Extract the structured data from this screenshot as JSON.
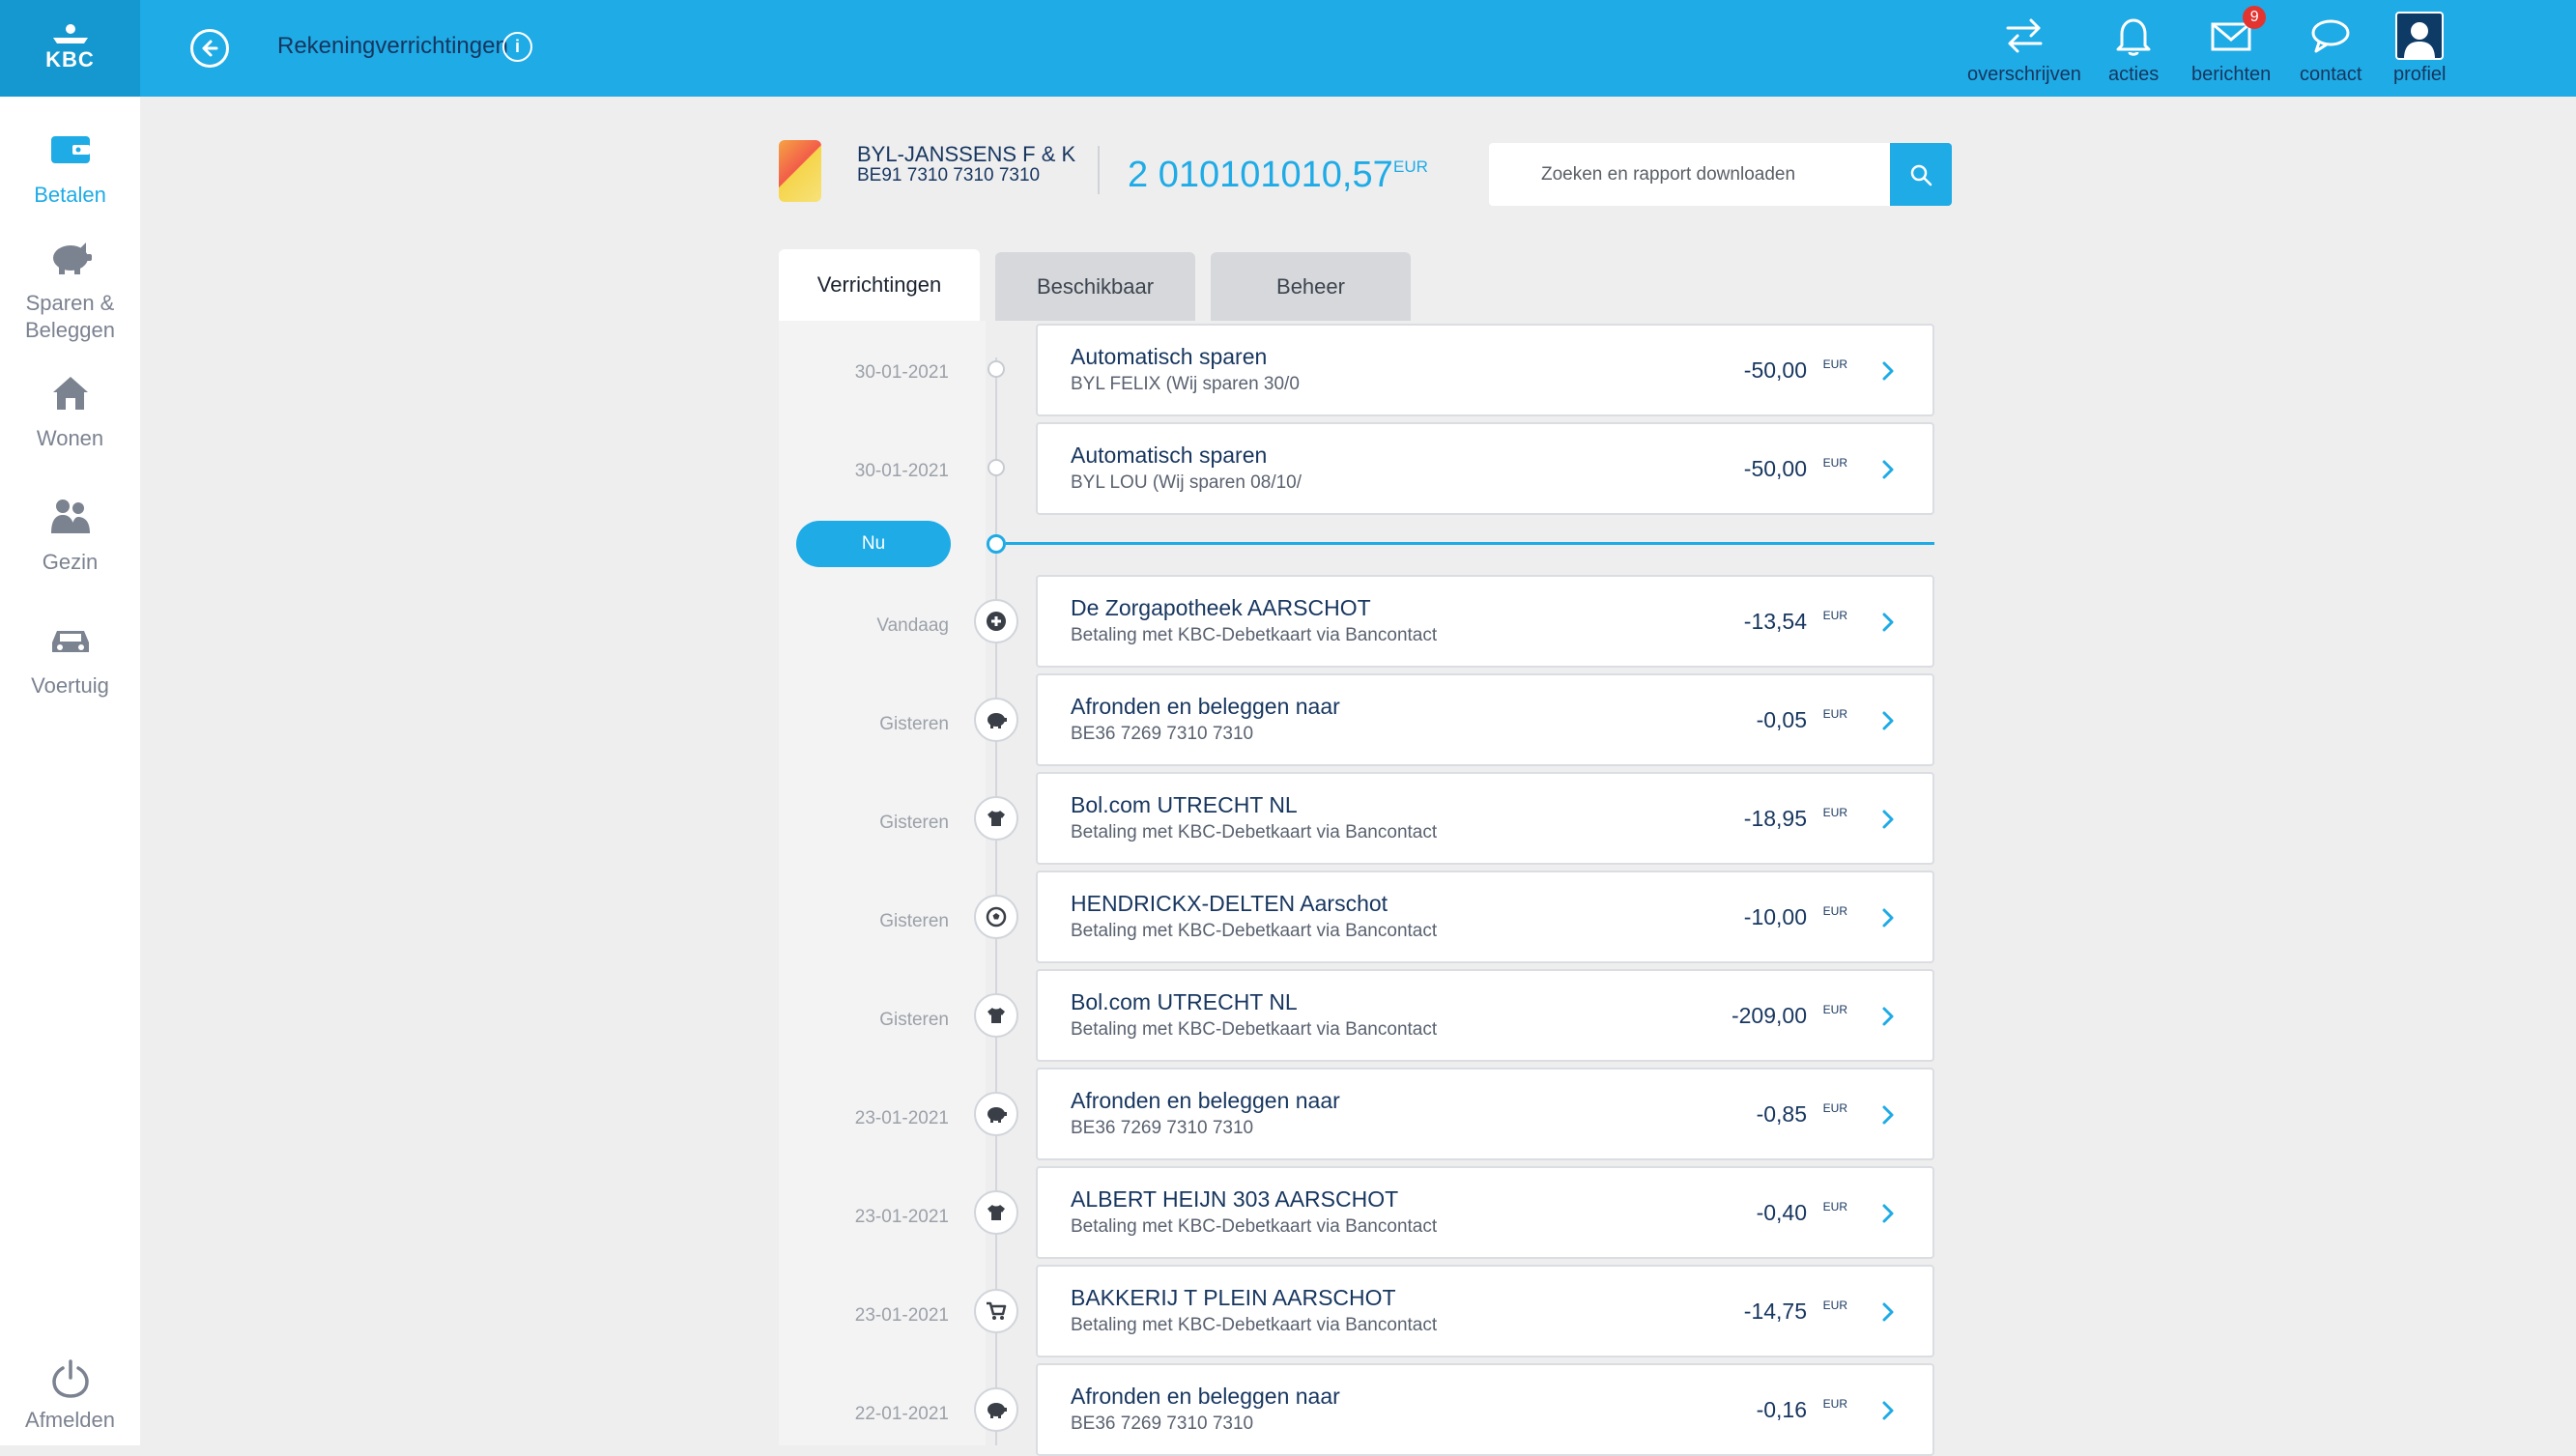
{
  "header": {
    "logo_text": "KBC",
    "title": "Rekeningverrichtingen",
    "actions": [
      {
        "label": "overschrijven",
        "icon": "transfer-icon"
      },
      {
        "label": "acties",
        "icon": "bell-icon"
      },
      {
        "label": "berichten",
        "icon": "mail-icon",
        "badge": "9"
      },
      {
        "label": "contact",
        "icon": "chat-icon"
      },
      {
        "label": "profiel",
        "icon": "profile-icon"
      }
    ]
  },
  "sidebar": {
    "items": [
      {
        "label": "Betalen",
        "icon": "wallet-icon"
      },
      {
        "label": "Sparen & Beleggen",
        "icon": "piggybank-icon"
      },
      {
        "label": "Wonen",
        "icon": "house-icon"
      },
      {
        "label": "Gezin",
        "icon": "family-icon"
      },
      {
        "label": "Voertuig",
        "icon": "car-icon"
      }
    ],
    "logout_label": "Afmelden"
  },
  "account": {
    "name": "BYL-JANSSENS F & K",
    "iban": "BE91 7310 7310 7310",
    "balance": "2 010101010,57",
    "currency": "EUR"
  },
  "search": {
    "placeholder": "Zoeken en rapport downloaden"
  },
  "tabs": [
    {
      "label": "Verrichtingen",
      "active": true
    },
    {
      "label": "Beschikbaar",
      "active": false
    },
    {
      "label": "Beheer",
      "active": false
    }
  ],
  "now_label": "Nu",
  "future_transactions": [
    {
      "date": "30-01-2021",
      "title": "Automatisch sparen",
      "subtitle": "BYL FELIX (Wij sparen 30/0",
      "amount": "-50,00",
      "currency": "EUR"
    },
    {
      "date": "30-01-2021",
      "title": "Automatisch sparen",
      "subtitle": "BYL LOU (Wij sparen 08/10/",
      "amount": "-50,00",
      "currency": "EUR"
    }
  ],
  "transactions": [
    {
      "date": "Vandaag",
      "icon": "medical-icon",
      "title": "De Zorgapotheek AARSCHOT",
      "subtitle": "Betaling met KBC-Debetkaart via Bancontact",
      "amount": "-13,54",
      "currency": "EUR"
    },
    {
      "date": "Gisteren",
      "icon": "piggybank-icon",
      "title": "Afronden en beleggen naar",
      "subtitle": "BE36 7269 7310 7310",
      "amount": "-0,05",
      "currency": "EUR"
    },
    {
      "date": "Gisteren",
      "icon": "shirt-icon",
      "title": "Bol.com UTRECHT NL",
      "subtitle": "Betaling met KBC-Debetkaart via Bancontact",
      "amount": "-18,95",
      "currency": "EUR"
    },
    {
      "date": "Gisteren",
      "icon": "football-icon",
      "title": "HENDRICKX-DELTEN Aarschot",
      "subtitle": "Betaling met KBC-Debetkaart via Bancontact",
      "amount": "-10,00",
      "currency": "EUR"
    },
    {
      "date": "Gisteren",
      "icon": "shirt-icon",
      "title": "Bol.com UTRECHT NL",
      "subtitle": "Betaling met KBC-Debetkaart via Bancontact",
      "amount": "-209,00",
      "currency": "EUR"
    },
    {
      "date": "23-01-2021",
      "icon": "piggybank-icon",
      "title": "Afronden en beleggen naar",
      "subtitle": "BE36 7269 7310 7310",
      "amount": "-0,85",
      "currency": "EUR"
    },
    {
      "date": "23-01-2021",
      "icon": "shirt-icon",
      "title": "ALBERT HEIJN 303 AARSCHOT",
      "subtitle": "Betaling met KBC-Debetkaart via Bancontact",
      "amount": "-0,40",
      "currency": "EUR"
    },
    {
      "date": "23-01-2021",
      "icon": "cart-icon",
      "title": "BAKKERIJ T PLEIN AARSCHOT",
      "subtitle": "Betaling met KBC-Debetkaart via Bancontact",
      "amount": "-14,75",
      "currency": "EUR"
    },
    {
      "date": "22-01-2021",
      "icon": "piggybank-icon",
      "title": "Afronden en beleggen naar",
      "subtitle": "BE36 7269 7310 7310",
      "amount": "-0,16",
      "currency": "EUR"
    }
  ],
  "colors": {
    "brand": "#1eabe6",
    "brand_dark": "#1597cf",
    "text_dark": "#17365f"
  }
}
